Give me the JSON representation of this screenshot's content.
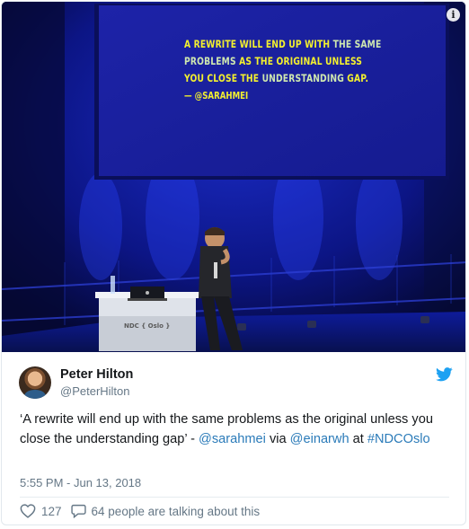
{
  "media": {
    "info_icon": "info-icon",
    "slide_lines": [
      {
        "parts": [
          {
            "text": "A rewrite will end up with ",
            "tone": "y"
          },
          {
            "text": "the same",
            "tone": "g"
          }
        ]
      },
      {
        "parts": [
          {
            "text": "problems ",
            "tone": "g"
          },
          {
            "text": "as the original unless",
            "tone": "y"
          }
        ]
      },
      {
        "parts": [
          {
            "text": "you close the ",
            "tone": "y"
          },
          {
            "text": "understanding ",
            "tone": "g"
          },
          {
            "text": "gap.",
            "tone": "y"
          }
        ]
      }
    ],
    "slide_credit": "— @sarahmei",
    "booth_label": "NDC { Oslo }",
    "colors": {
      "screen": "#1a1f9e",
      "stage": "#0b1370",
      "accent_yellow": "#f3f02e"
    }
  },
  "tweet": {
    "author_name": "Peter Hilton",
    "author_handle": "@PeterHilton",
    "bird_icon": "twitter-bird-icon",
    "text_parts": {
      "p1": "‘A rewrite will end up with the same problems as the original unless you close the understanding gap’ - ",
      "mention1": "@sarahmei",
      "via": " via ",
      "mention2": "@einarwh",
      "at": " at ",
      "hashtag": "#NDCOslo"
    },
    "timestamp": "5:55 PM - Jun 13, 2018",
    "likes": "127",
    "talking": "64 people are talking about this",
    "colors": {
      "link": "#2b7bb9",
      "muted": "#657786",
      "bird": "#1da1f2"
    }
  }
}
